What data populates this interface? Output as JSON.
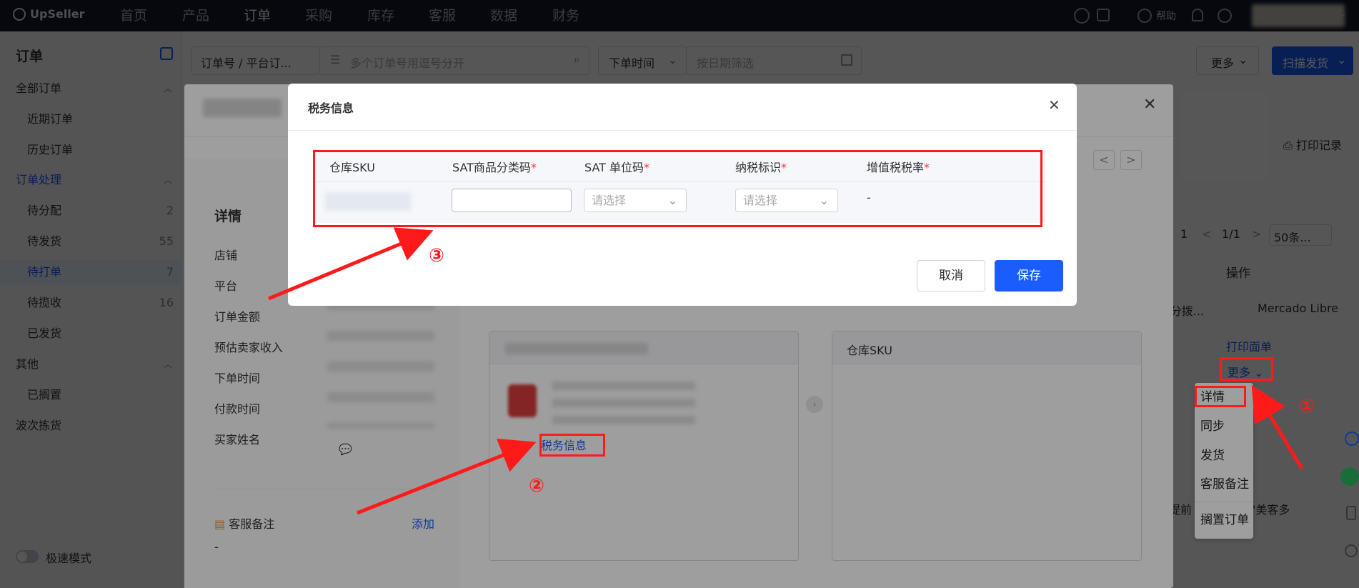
{
  "topbar": {
    "logo": "UpSeller",
    "nav": [
      "首页",
      "产品",
      "订单",
      "采购",
      "库存",
      "客服",
      "数据",
      "财务"
    ],
    "help": "帮助"
  },
  "sidebar": {
    "title": "订单",
    "groups": [
      {
        "label": "全部订单",
        "items": [
          {
            "label": "近期订单",
            "count": ""
          },
          {
            "label": "历史订单",
            "count": ""
          }
        ]
      },
      {
        "label": "订单处理",
        "items": [
          {
            "label": "待分配",
            "count": "2"
          },
          {
            "label": "待发货",
            "count": "55"
          },
          {
            "label": "待打单",
            "count": "7"
          },
          {
            "label": "待揽收",
            "count": "16"
          },
          {
            "label": "已发货",
            "count": ""
          }
        ]
      },
      {
        "label": "其他",
        "items": [
          {
            "label": "已搁置",
            "count": ""
          }
        ]
      }
    ],
    "wave": "波次拣货",
    "speed_mode": "极速模式"
  },
  "filters": {
    "order_select": "订单号 / 平台订...",
    "order_placeholder": "多个订单号用逗号分开",
    "time_select": "下单时间",
    "date_placeholder": "按日期筛选",
    "more": "更多",
    "scan": "扫描发货"
  },
  "right": {
    "print_record": "打印记录",
    "page_a": "1",
    "page_info": "1/1",
    "page_size": "50条...",
    "col_op": "操作",
    "cell_1": "-分拨...",
    "cell_platform": "Mercado Libre",
    "print_label": "打印面单",
    "more": "更多",
    "bottom_text_a": "提前",
    "bottom_text_b": "请开启\"美客多"
  },
  "dropdown": [
    "详情",
    "同步",
    "发货",
    "客服备注",
    "搁置订单"
  ],
  "detail": {
    "heading": "详情",
    "fields": [
      "店铺",
      "平台",
      "订单金额",
      "预估卖家收入",
      "下单时间",
      "付款时间",
      "买家姓名"
    ],
    "service_note": "客服备注",
    "add": "添加",
    "note_value": "-",
    "tax_link": "税务信息",
    "wh_sku": "仓库SKU"
  },
  "modal": {
    "title": "税务信息",
    "columns": [
      "仓库SKU",
      "SAT商品分类码",
      "SAT 单位码",
      "纳税标识",
      "增值税税率"
    ],
    "select_placeholder": "请选择",
    "vat_value": "-",
    "cancel": "取消",
    "save": "保存"
  },
  "annotations": {
    "one": "①",
    "two": "②",
    "three": "③"
  },
  "colors": {
    "primary": "#1a5cff",
    "annotation": "#ff1a1a",
    "topbar": "#151a2c"
  }
}
